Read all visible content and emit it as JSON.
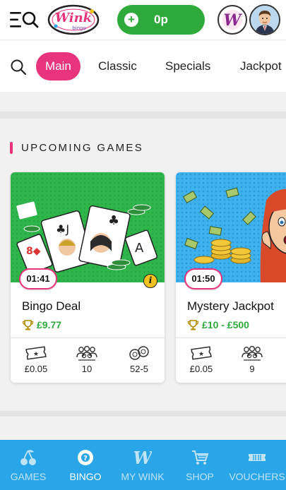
{
  "header": {
    "balance_plus": "+",
    "balance": "0p",
    "logo_text": "Wink bingo",
    "wink_badge": "W"
  },
  "tabs": {
    "items": [
      {
        "label": "Main",
        "active": true
      },
      {
        "label": "Classic",
        "active": false
      },
      {
        "label": "Specials",
        "active": false
      },
      {
        "label": "Jackpot",
        "active": false
      }
    ]
  },
  "section": {
    "title": "UPCOMING GAMES"
  },
  "games": [
    {
      "timer": "01:41",
      "name": "Bingo Deal",
      "prize": "£9.77",
      "ticket_price": "£0.05",
      "players": "10",
      "format": "52-5",
      "info": "i"
    },
    {
      "timer": "01:50",
      "name": "Mystery Jackpot",
      "prize": "£10 - £500",
      "ticket_price": "£0.05",
      "players": "9"
    }
  ],
  "bottom_nav": {
    "items": [
      {
        "label": "GAMES",
        "icon": "cherries-icon",
        "active": false
      },
      {
        "label": "BINGO",
        "icon": "bingo-ball-icon",
        "active": true
      },
      {
        "label": "MY WINK",
        "icon": "wink-w-icon",
        "active": false
      },
      {
        "label": "SHOP",
        "icon": "cart-icon",
        "active": false
      },
      {
        "label": "VOUCHERS",
        "icon": "ticket-icon",
        "active": false
      }
    ]
  },
  "colors": {
    "brand_pink": "#e8337d",
    "balance_green": "#2eaa3c",
    "nav_blue": "#2aa6e8"
  }
}
